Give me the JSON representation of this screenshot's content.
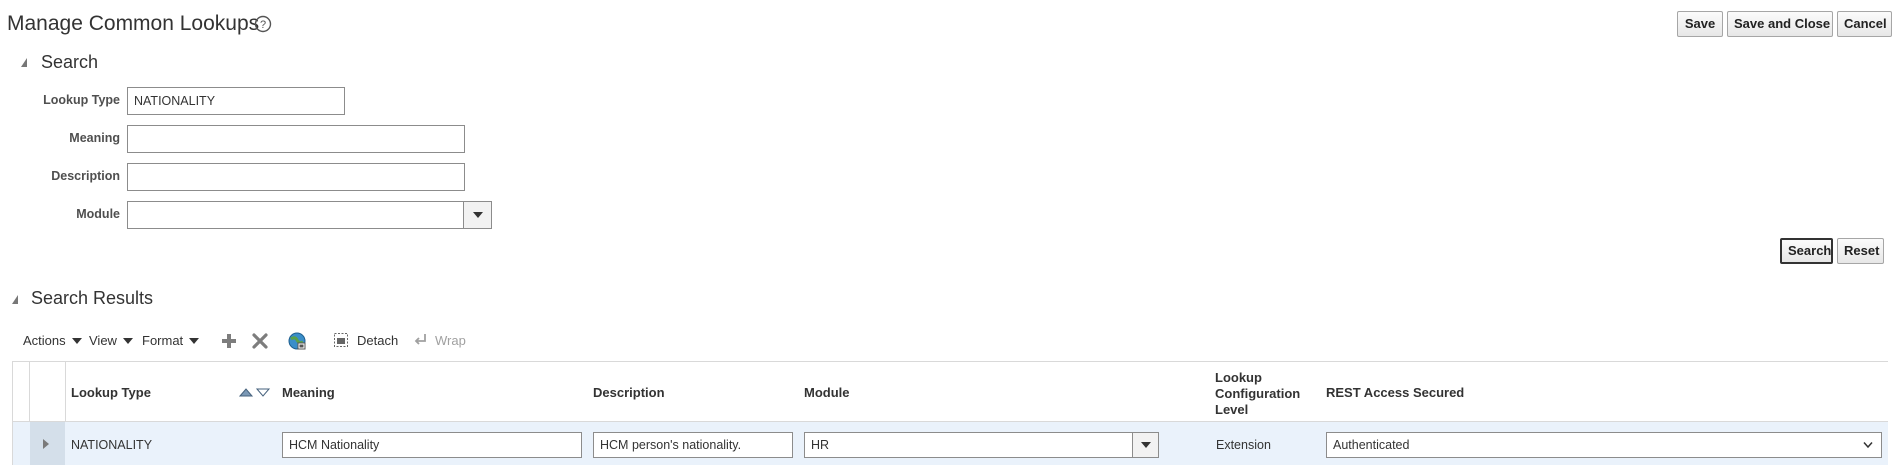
{
  "header": {
    "title": "Manage Common Lookups",
    "save_label": "Save",
    "save_close_label": "Save and Close",
    "cancel_label": "Cancel"
  },
  "search": {
    "section_title": "Search",
    "fields": {
      "lookup_type": {
        "label": "Lookup Type",
        "value": "NATIONALITY"
      },
      "meaning": {
        "label": "Meaning",
        "value": ""
      },
      "description": {
        "label": "Description",
        "value": ""
      },
      "module": {
        "label": "Module",
        "value": ""
      }
    },
    "search_label": "Search",
    "reset_label": "Reset"
  },
  "results": {
    "section_title": "Search Results",
    "toolbar": {
      "actions": "Actions",
      "view": "View",
      "format": "Format",
      "detach": "Detach",
      "wrap": "Wrap"
    },
    "columns": {
      "lookup_type": "Lookup Type",
      "meaning": "Meaning",
      "description": "Description",
      "module": "Module",
      "config_level": [
        "Lookup",
        "Configuration",
        "Level"
      ],
      "rest_access": "REST Access Secured"
    },
    "rows": [
      {
        "lookup_type": "NATIONALITY",
        "meaning": "HCM Nationality",
        "description": "HCM person's nationality.",
        "module": "HR",
        "config_level": "Extension",
        "rest_access": "Authenticated"
      }
    ]
  },
  "colors": {
    "selected_row": "#eaf2fb",
    "selector_cell": "#d4dfea",
    "border": "#8c8c8c",
    "add_icon": "#7d7d7d",
    "delete_icon": "#7d7d7d",
    "disabled_text": "#a0a0a0"
  },
  "icons": [
    "help-icon",
    "disclose-icon",
    "add-icon",
    "delete-icon",
    "globe-icon",
    "detach-icon",
    "wrap-icon",
    "sort-ascending-icon",
    "sort-descending-icon",
    "expand-row-icon",
    "dropdown-icon"
  ]
}
